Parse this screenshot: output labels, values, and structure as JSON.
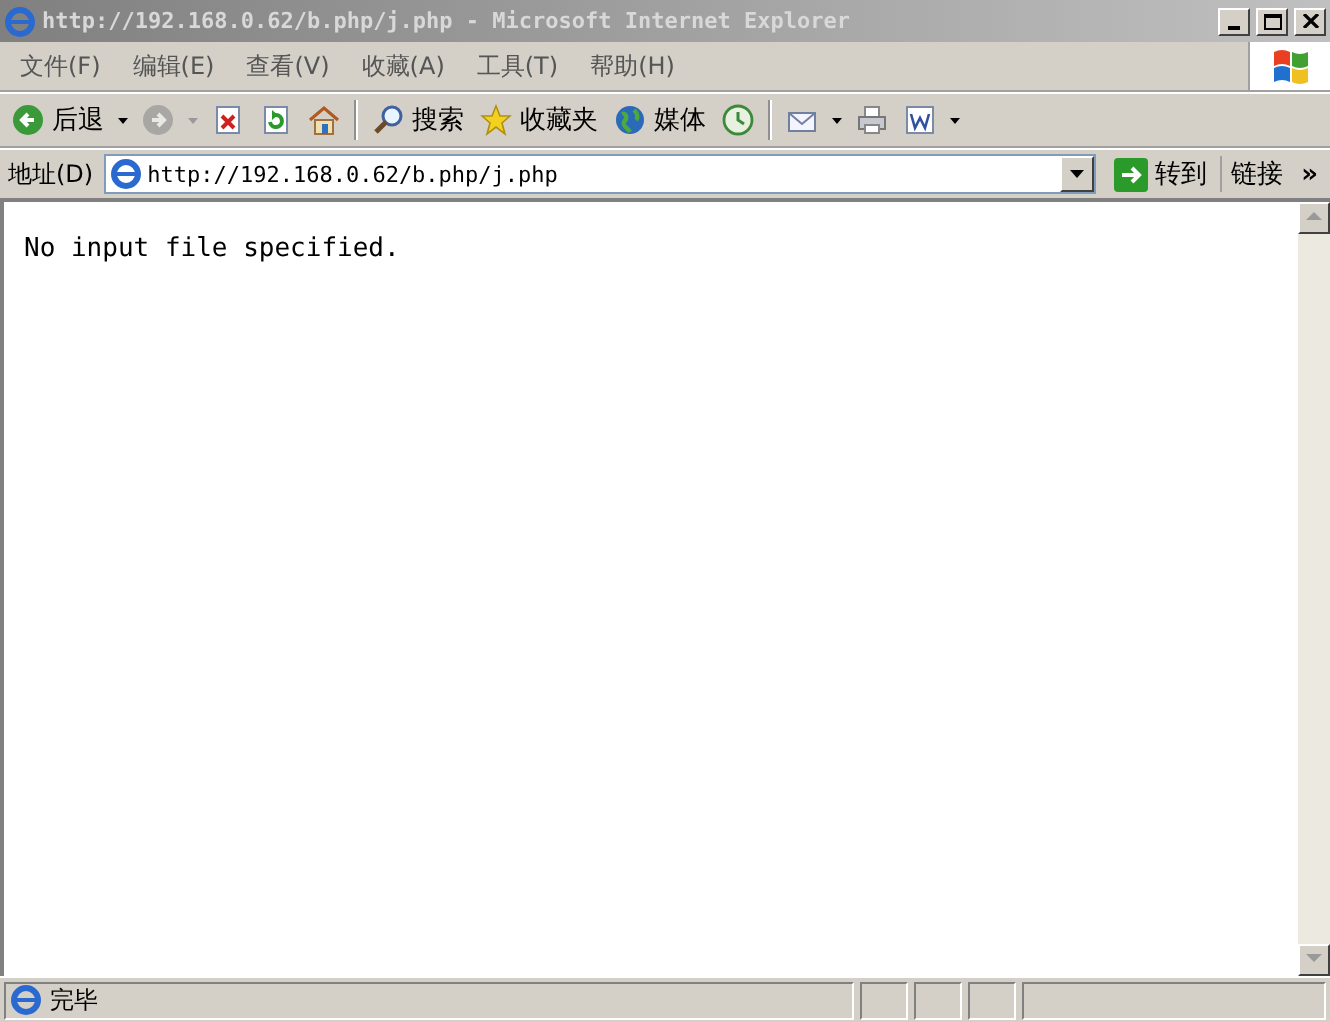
{
  "window": {
    "title": "http://192.168.0.62/b.php/j.php - Microsoft Internet Explorer"
  },
  "menu": [
    {
      "label": "文件(F)"
    },
    {
      "label": "编辑(E)"
    },
    {
      "label": "查看(V)"
    },
    {
      "label": "收藏(A)"
    },
    {
      "label": "工具(T)"
    },
    {
      "label": "帮助(H)"
    }
  ],
  "toolbar": [
    {
      "kind": "back",
      "label": "后退",
      "dropdown": true,
      "disabled": false
    },
    {
      "kind": "forward",
      "dropdown": true,
      "disabled": true
    },
    {
      "kind": "stop",
      "dropdown": false,
      "disabled": false
    },
    {
      "kind": "refresh",
      "dropdown": false,
      "disabled": false
    },
    {
      "kind": "home",
      "dropdown": false,
      "disabled": false
    },
    {
      "kind": "separator"
    },
    {
      "kind": "search",
      "label": "搜索",
      "dropdown": false,
      "disabled": false
    },
    {
      "kind": "favorites",
      "label": "收藏夹",
      "dropdown": false,
      "disabled": false
    },
    {
      "kind": "media",
      "label": "媒体",
      "dropdown": false,
      "disabled": false
    },
    {
      "kind": "history",
      "dropdown": false,
      "disabled": false
    },
    {
      "kind": "separator"
    },
    {
      "kind": "mail",
      "dropdown": true,
      "disabled": false
    },
    {
      "kind": "print",
      "dropdown": false,
      "disabled": false
    },
    {
      "kind": "edit",
      "dropdown": true,
      "disabled": false
    }
  ],
  "address_bar": {
    "label": "地址(D)",
    "value": "http://192.168.0.62/b.php/j.php",
    "go_button": "转到",
    "links": "链接",
    "more": "»"
  },
  "content": {
    "text": "No input file specified."
  },
  "status_bar": {
    "text": "完毕"
  }
}
